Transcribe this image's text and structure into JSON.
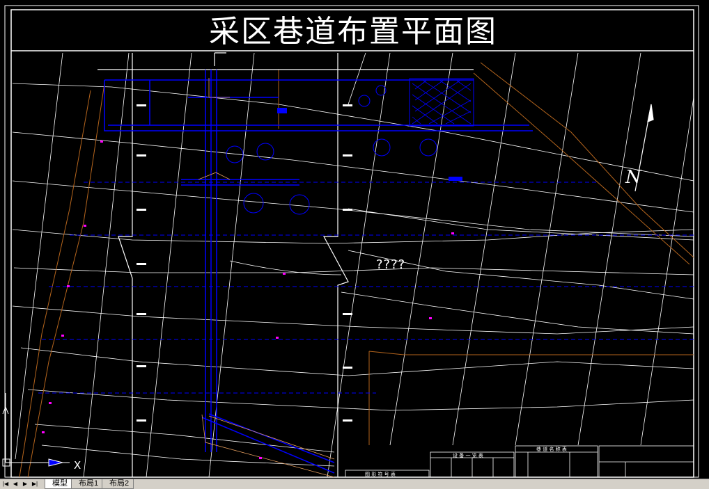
{
  "drawing": {
    "title": "采区巷道布置平面图",
    "question_marks": "????",
    "north_label": "N",
    "table_titles": {
      "legend": "图 形 符 号 表",
      "equipment": "设 备 一 览 表",
      "roadway_names": "巷 道 名 称 表"
    }
  },
  "ucs": {
    "x_label": "X"
  },
  "tabs": {
    "nav_first": "|◀",
    "nav_prev": "◀",
    "nav_next": "▶",
    "nav_last": "▶|",
    "items": [
      {
        "label": "模型"
      },
      {
        "label": "布局1"
      },
      {
        "label": "布局2"
      }
    ]
  },
  "colors": {
    "background": "#000000",
    "frame": "#ffffff",
    "roadway": "#0000ff",
    "contour": "#ffffff",
    "fault": "#b5651d",
    "marker": "#ff00ff"
  }
}
